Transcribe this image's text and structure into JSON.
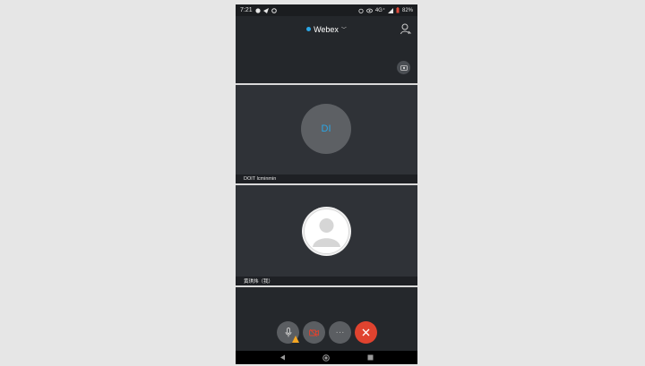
{
  "status_bar": {
    "time": "7:21",
    "network": "4G⁺",
    "battery": "82%"
  },
  "header": {
    "app_title": "Webex"
  },
  "participants": [
    {
      "initials": "DI",
      "name": "DOIT lcminmin"
    },
    {
      "name": "黄琪炜（我）"
    }
  ],
  "colors": {
    "accent": "#2aa6e6",
    "end_call": "#e0432f",
    "warning": "#f5a623"
  }
}
